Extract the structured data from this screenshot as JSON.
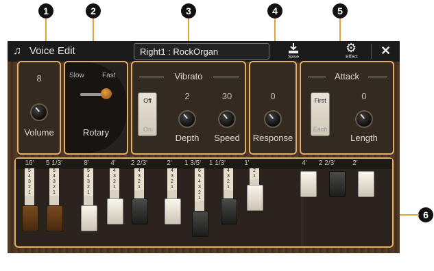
{
  "callouts": [
    "1",
    "2",
    "3",
    "4",
    "5",
    "6"
  ],
  "titlebar": {
    "app_title": "Voice Edit",
    "voice_name": "Right1 : RockOrgan",
    "save_label": "Save",
    "effect_label": "Effect",
    "close_symbol": "✕"
  },
  "volume": {
    "value": "8",
    "label": "Volume"
  },
  "rotary": {
    "slow_label": "Slow",
    "fast_label": "Fast",
    "label": "Rotary"
  },
  "vibrato": {
    "title": "Vibrato",
    "toggle_off": "Off",
    "toggle_on": "On",
    "depth_value": "2",
    "depth_label": "Depth",
    "speed_value": "30",
    "speed_label": "Speed"
  },
  "response": {
    "value": "0",
    "label": "Response"
  },
  "attack": {
    "title": "Attack",
    "toggle_first": "First",
    "toggle_each": "Each",
    "length_value": "0",
    "length_label": "Length"
  },
  "footages": [
    "16'",
    "5 1/3'",
    "8'",
    "4'",
    "2 2/3'",
    "2'",
    "1 3/5'",
    "1 1/3'",
    "1'",
    "4'",
    "2 2/3'",
    "2'"
  ],
  "drawbar_numbers": [
    [
      "5",
      "4",
      "3",
      "2",
      "1"
    ],
    [
      "5",
      "4",
      "3",
      "2",
      "1"
    ],
    [
      "5",
      "4",
      "3",
      "2",
      "1"
    ],
    [
      "4",
      "3",
      "2",
      "1"
    ],
    [
      "4",
      "3",
      "2",
      "1"
    ],
    [
      "4",
      "3",
      "2",
      "1"
    ],
    [
      "6",
      "5",
      "4",
      "3",
      "2",
      "1"
    ],
    [
      "4",
      "3",
      "2",
      "1"
    ],
    [
      "2",
      "1"
    ]
  ],
  "colors": {
    "accent": "#e3b06a",
    "callout": "#111111"
  }
}
